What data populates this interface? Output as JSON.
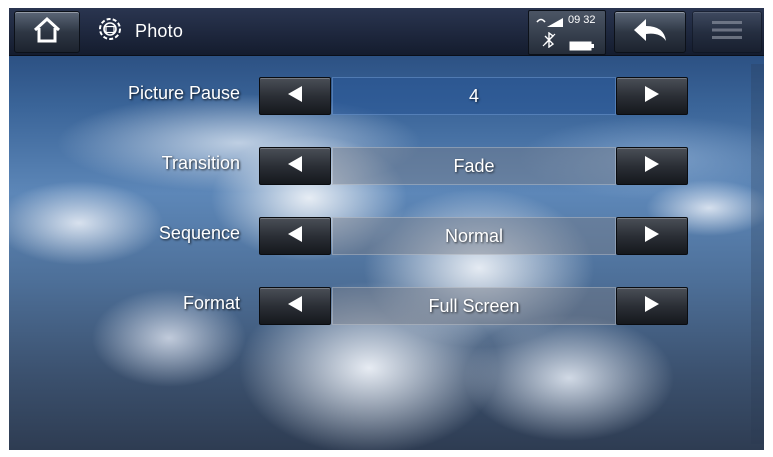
{
  "header": {
    "title": "Photo",
    "home_icon": "home-icon",
    "app_icon": "gear-photo-icon",
    "back_icon": "back-arrow-icon",
    "menu_icon": "menu-icon"
  },
  "status": {
    "time": "09 32",
    "signal_icon": "wifi-signal-icon",
    "bluetooth_icon": "bluetooth-off-icon",
    "battery_icon": "battery-icon"
  },
  "settings": [
    {
      "label": "Picture Pause",
      "value": "4",
      "active": true
    },
    {
      "label": "Transition",
      "value": "Fade",
      "active": false
    },
    {
      "label": "Sequence",
      "value": "Normal",
      "active": false
    },
    {
      "label": "Format",
      "value": "Full Screen",
      "active": false
    }
  ]
}
